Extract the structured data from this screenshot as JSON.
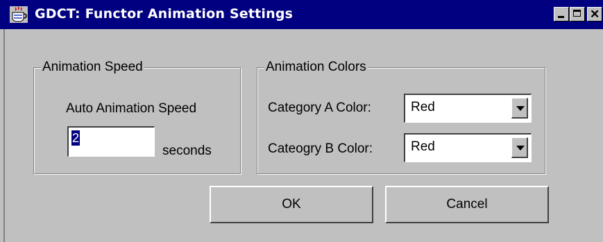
{
  "window": {
    "title": "GDCT: Functor Animation Settings",
    "app_icon": "java-cup-icon",
    "controls": {
      "minimize": "minimize-icon",
      "maximize": "maximize-icon",
      "close": "close-icon",
      "close_glyph": "✕"
    }
  },
  "speed_group": {
    "legend": "Animation Speed",
    "label": "Auto Animation Speed",
    "value": "2",
    "unit": "seconds"
  },
  "colors_group": {
    "legend": "Animation Colors",
    "category_a_label": "Category A Color:",
    "category_a_value": "Red",
    "category_b_label": "Cateogry B Color:",
    "category_b_value": "Red"
  },
  "buttons": {
    "ok": "OK",
    "cancel": "Cancel"
  },
  "colors": {
    "titlebar": "#000080",
    "face": "#c0c0c0",
    "selection": "#000080"
  }
}
